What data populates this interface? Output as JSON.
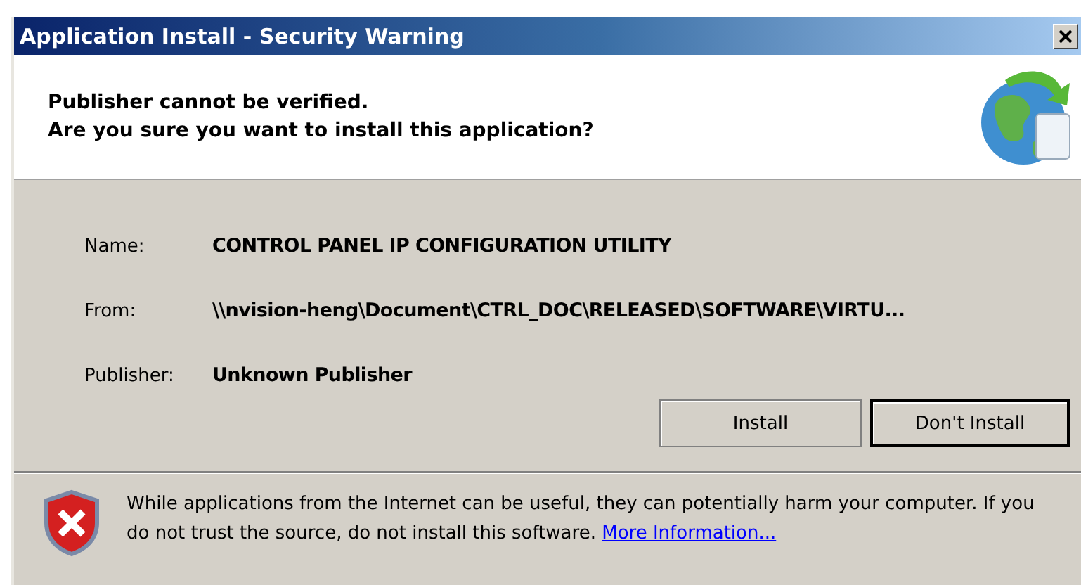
{
  "window": {
    "title": "Application Install - Security Warning"
  },
  "header": {
    "lines": [
      "Publisher cannot be verified.",
      "Are you sure you want to install this application?"
    ]
  },
  "details": [
    {
      "label": "Name:",
      "value": "CONTROL PANEL IP CONFIGURATION UTILITY"
    },
    {
      "label": "From:",
      "value": "\\\\nvision-heng\\Document\\CTRL_DOC\\RELEASED\\SOFTWARE\\VIRTU..."
    },
    {
      "label": "Publisher:",
      "value": "Unknown Publisher"
    }
  ],
  "buttons": [
    {
      "label": "Install",
      "default": false
    },
    {
      "label": "Don't Install",
      "default": true
    }
  ],
  "warning": {
    "text": "While applications from the Internet can be useful, they can potentially harm your computer. If you do not trust the source, do not install this software.",
    "link": "More Information..."
  }
}
